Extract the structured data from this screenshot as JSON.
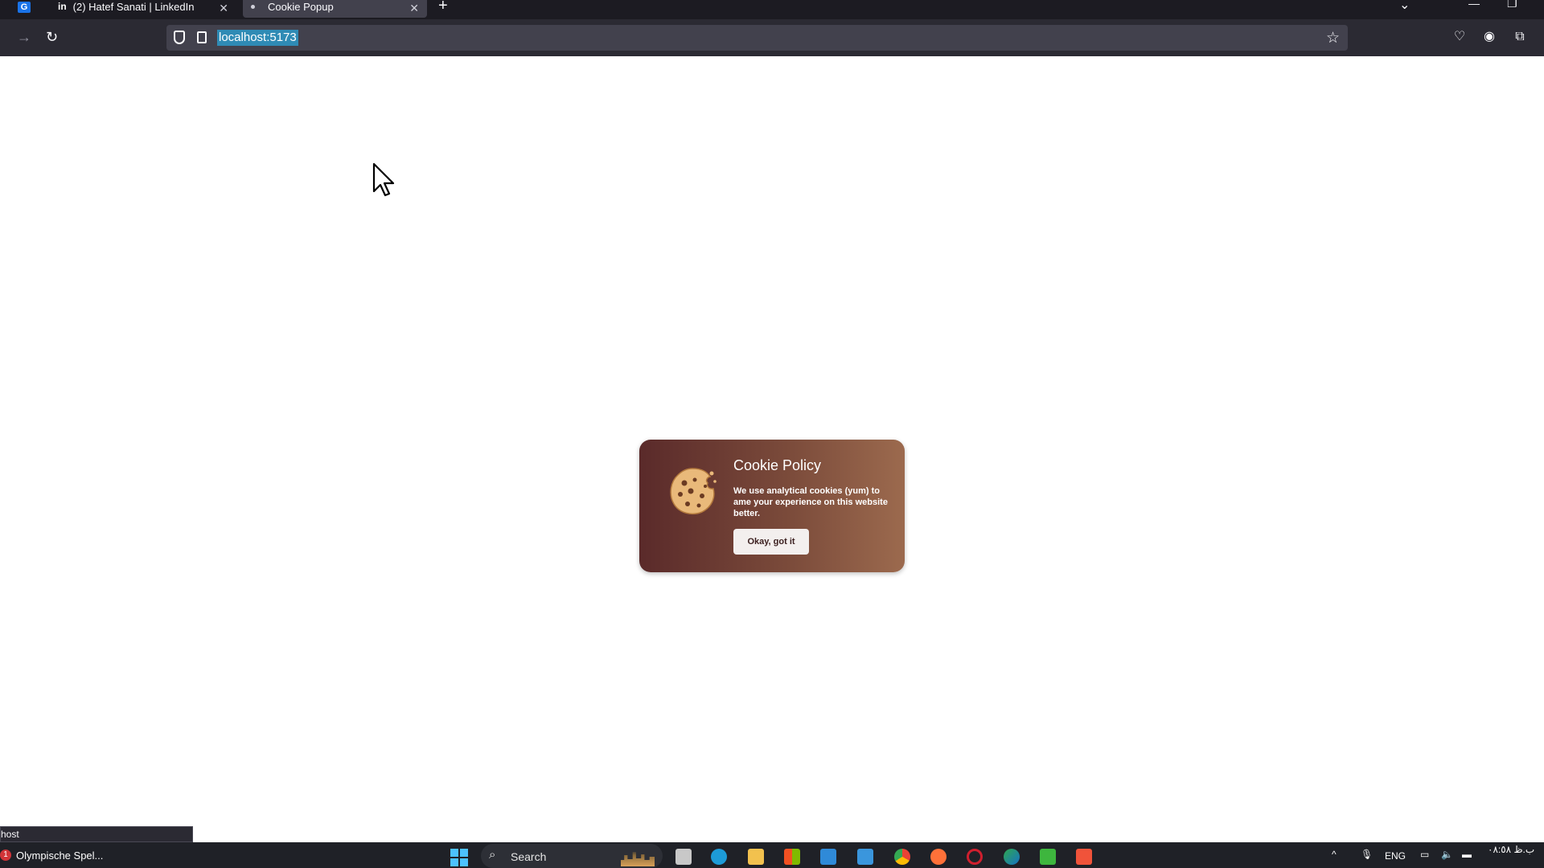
{
  "browser": {
    "tabs": [
      {
        "label": "",
        "icon": "google-icon"
      },
      {
        "label": "(2) Hatef Sanati | LinkedIn",
        "icon": "linkedin-icon"
      },
      {
        "label": "Cookie Popup",
        "icon": "page-dot-icon",
        "active": true
      }
    ],
    "address": "localhost:5173"
  },
  "cookie": {
    "title": "Cookie Policy",
    "text": "We use analytical cookies (yum) to ame your experience on this website better.",
    "button": "Okay, got it"
  },
  "status_link": "host",
  "taskbar": {
    "news": "Olympische Spel...",
    "news_badge": "1",
    "search": "Search",
    "language": "ENG",
    "clock": "ب.ظ ٠٨:٥٨"
  },
  "colors": {
    "card_gradient_start": "#5a2a2a",
    "card_gradient_end": "#9c6a4e",
    "tab_bar": "#1c1b22",
    "url_highlight": "#2f8bb5"
  }
}
